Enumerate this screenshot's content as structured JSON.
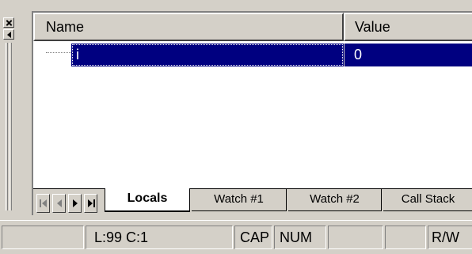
{
  "window": {
    "close_icon": "close-icon",
    "float_icon": "arrow-left-icon"
  },
  "columns": {
    "name": "Name",
    "value": "Value"
  },
  "rows": [
    {
      "name": "i",
      "value": "0",
      "selected": true
    }
  ],
  "tabs": {
    "nav_icons": [
      "first-icon",
      "prev-icon",
      "next-icon",
      "last-icon"
    ],
    "items": [
      "Locals",
      "Watch #1",
      "Watch #2",
      "Call Stack"
    ],
    "active": "Locals"
  },
  "statusbar": {
    "message": "",
    "position": "L:99 C:1",
    "cap": "CAP",
    "num": "NUM",
    "ovr": "",
    "rec": "",
    "rw": "R/W"
  },
  "colors": {
    "selection": "#000080",
    "face": "#d4d0c8"
  }
}
